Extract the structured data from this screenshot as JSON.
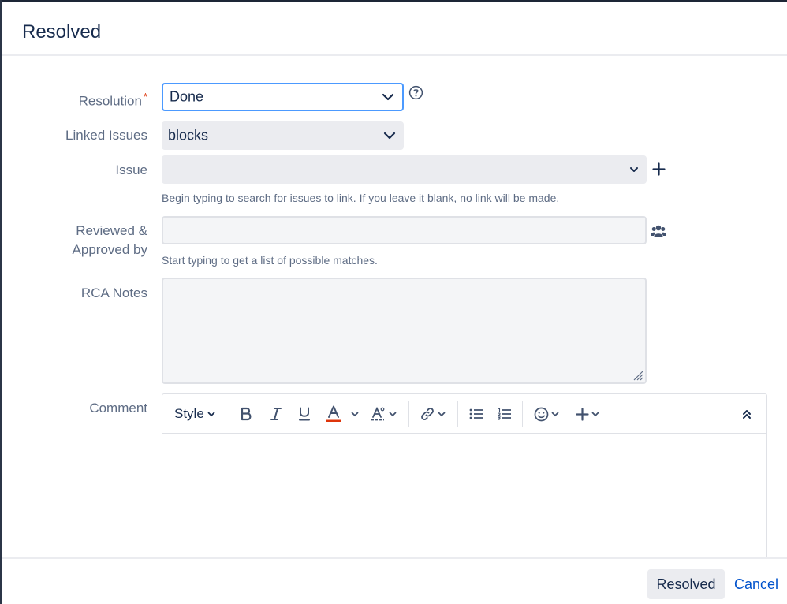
{
  "dialog": {
    "title": "Resolved"
  },
  "form": {
    "resolution": {
      "label": "Resolution",
      "required_mark": "*",
      "value": "Done"
    },
    "linked_issues": {
      "label": "Linked Issues",
      "value": "blocks"
    },
    "issue": {
      "label": "Issue",
      "value": "",
      "hint": "Begin typing to search for issues to link. If you leave it blank, no link will be made."
    },
    "reviewed": {
      "label_line1": "Reviewed &",
      "label_line2": "Approved by",
      "value": "",
      "hint": "Start typing to get a list of possible matches."
    },
    "rca_notes": {
      "label": "RCA Notes",
      "value": ""
    },
    "comment": {
      "label": "Comment",
      "style_label": "Style"
    }
  },
  "footer": {
    "submit_label": "Resolved",
    "cancel_label": "Cancel"
  },
  "colors": {
    "accent": "#0052cc",
    "focus": "#4c9aff",
    "required": "#de350b",
    "text_color_underline": "#de350b"
  }
}
